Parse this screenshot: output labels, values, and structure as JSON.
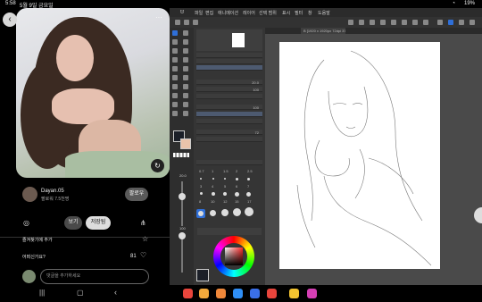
{
  "status_bar": {
    "time": "5:58",
    "date": "5월 9일 금요일",
    "battery": "19%"
  },
  "pin": {
    "more_icon": "···",
    "user_name": "Dayan.05",
    "followers": "팔로워 7.5천명",
    "follow_label": "팔로우",
    "view_label": "보기",
    "save_label": "저장됨",
    "favorites_label": "즐겨찾기에 추가",
    "comment_question": "어떠신가요?",
    "like_count": "81",
    "comment_placeholder": "댓글을 추가하세요"
  },
  "csp": {
    "menu": [
      "파일",
      "편집",
      "애니메이션",
      "레이어",
      "선택 범위",
      "표시",
      "필터",
      "창",
      "도움말"
    ],
    "canvas_tab": "B [1920 x 1920px 72dpi 37.7%]",
    "brush_size": "20.0",
    "opacity": "100",
    "zoom_value": "37.7",
    "brush_sizes": [
      "0.7",
      "1",
      "1.5",
      "2",
      "2.5",
      "3",
      "4",
      "5",
      "6",
      "7",
      "8",
      "10",
      "12",
      "15",
      "17"
    ],
    "prop_values": [
      "20.0",
      "100",
      "100",
      "72"
    ]
  },
  "colors": {
    "main_color": "#1b1f28",
    "sub_color": "#e9c3ab",
    "accent": "#2f6fd8"
  }
}
